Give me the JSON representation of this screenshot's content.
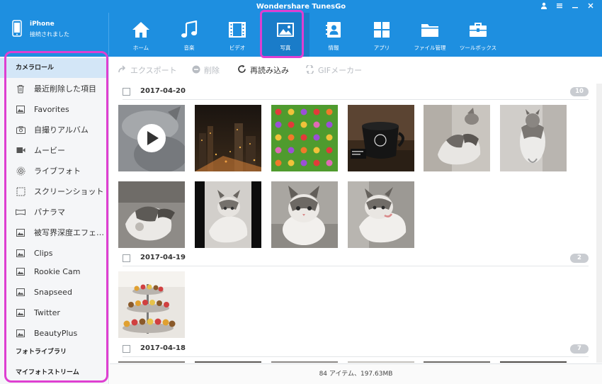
{
  "window": {
    "title": "Wondershare TunesGo",
    "controls": [
      "user-icon",
      "menu-icon",
      "minimize-icon",
      "close-icon"
    ]
  },
  "device": {
    "name": "iPhone",
    "status": "接続されました"
  },
  "nav": {
    "items": [
      {
        "label": "ホーム",
        "icon": "home-icon"
      },
      {
        "label": "音楽",
        "icon": "music-icon"
      },
      {
        "label": "ビデオ",
        "icon": "video-icon"
      },
      {
        "label": "写真",
        "icon": "photo-icon",
        "active": true
      },
      {
        "label": "情報",
        "icon": "contacts-icon"
      },
      {
        "label": "アプリ",
        "icon": "apps-icon"
      },
      {
        "label": "ファイル管理",
        "icon": "folder-icon"
      },
      {
        "label": "ツールボックス",
        "icon": "toolbox-icon"
      }
    ]
  },
  "sidebar": {
    "sections": [
      "カメラロール",
      "フォトライブラリ",
      "マイフォトストリーム"
    ],
    "items": [
      {
        "label": "最近削除した項目",
        "icon": "trash-icon"
      },
      {
        "label": "Favorites",
        "icon": "image-icon"
      },
      {
        "label": "自撮りアルバム",
        "icon": "selfie-camera-icon"
      },
      {
        "label": "ムービー",
        "icon": "movie-icon"
      },
      {
        "label": "ライブフォト",
        "icon": "live-photo-icon"
      },
      {
        "label": "スクリーンショット",
        "icon": "screenshot-icon"
      },
      {
        "label": "パナラマ",
        "icon": "panorama-icon"
      },
      {
        "label": "被写界深度エフェクト",
        "icon": "image-icon"
      },
      {
        "label": "Clips",
        "icon": "image-icon"
      },
      {
        "label": "Rookie Cam",
        "icon": "image-icon"
      },
      {
        "label": "Snapseed",
        "icon": "image-icon"
      },
      {
        "label": "Twitter",
        "icon": "image-icon"
      },
      {
        "label": "BeautyPlus",
        "icon": "image-icon"
      }
    ]
  },
  "toolbar": {
    "export_label": "エクスポート",
    "delete_label": "削除",
    "reload_label": "再読み込み",
    "gif_label": "GIFメーカー"
  },
  "groups": [
    {
      "date": "2017-04-20",
      "count": "10"
    },
    {
      "date": "2017-04-19",
      "count": "2"
    },
    {
      "date": "2017-04-18",
      "count": "7"
    }
  ],
  "status": {
    "summary": "84 アイテム、197.63MB"
  },
  "colors": {
    "header_blue": "#1e8fe0",
    "active_tab": "#1a7cc9",
    "highlight_magenta": "#de3fd1",
    "sidebar_active": "#d3e6f7"
  }
}
